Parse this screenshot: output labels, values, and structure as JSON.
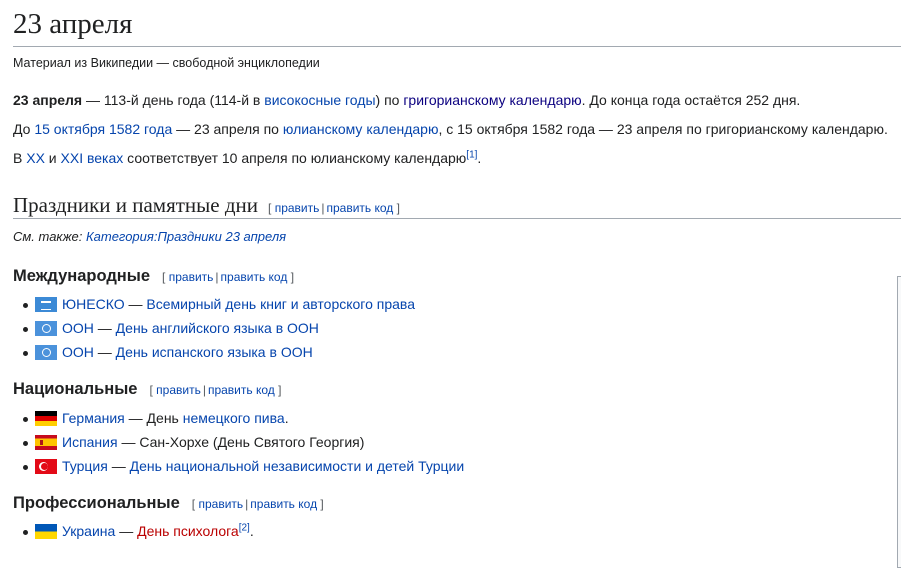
{
  "page": {
    "title": "23 апреля",
    "site_sub": "Материал из Википедии — свободной энциклопедии"
  },
  "intro": {
    "p1": {
      "bold": "23 апреля",
      "t1": " — 113-й день года (114-й в ",
      "link1": "високосные годы",
      "t2": ") по ",
      "link2": "григорианскому календарю",
      "t3": ". До конца года остаётся 252 дня."
    },
    "p2": {
      "t1": "До ",
      "link1": "15 октября 1582 года",
      "t2": " — 23 апреля по ",
      "link2": "юлианскому календарю",
      "t3": ", с 15 октября 1582 года — 23 апреля по григорианскому календарю."
    },
    "p3": {
      "t1": "В ",
      "link1": "XX",
      "t2": " и ",
      "link2": "XXI веках",
      "t3": " соответствует 10 апреля по юлианскому календарю",
      "ref": "[1]",
      "t4": "."
    }
  },
  "edit_links": {
    "edit": "править",
    "edit_code": "править код",
    "open": "[",
    "close": "]",
    "sep": "|"
  },
  "section": {
    "title": "Праздники и памятные дни",
    "see_also_label": "См. также: ",
    "see_also_link": "Категория:Праздники 23 апреля"
  },
  "subsections": {
    "international": {
      "title": "Международные",
      "items": [
        {
          "flag": "unesco-flag-icon",
          "org": "ЮНЕСКО",
          "dash": " — ",
          "event": "Всемирный день книг и авторского права"
        },
        {
          "flag": "un-flag-icon",
          "org": "ООН",
          "dash": " — ",
          "event": "День английского языка в ООН"
        },
        {
          "flag": "un-flag-icon",
          "org": "ООН",
          "dash": " — ",
          "event": "День испанского языка в ООН"
        }
      ]
    },
    "national": {
      "title": "Национальные",
      "items": [
        {
          "flag": "germany-flag-icon",
          "country": "Германия",
          "t1": " — День ",
          "link": "немецкого пива",
          "t2": "."
        },
        {
          "flag": "spain-flag-icon",
          "country": "Испания",
          "t1": " — Сан-Хорхе (День Святого Георгия)"
        },
        {
          "flag": "turkey-flag-icon",
          "country": "Турция",
          "dash": " — ",
          "event": "День национальной независимости и детей Турции"
        }
      ]
    },
    "professional": {
      "title": "Профессиональные",
      "items": [
        {
          "flag": "ukraine-flag-icon",
          "country": "Украина",
          "dash": " — ",
          "event": "День психолога",
          "ref": "[2]",
          "t2": "."
        }
      ]
    }
  },
  "colors": {
    "link": "#0645ad",
    "visited": "#0b0080",
    "redlink": "#ba0000",
    "text": "#202122",
    "rule": "#a2a9b1"
  }
}
